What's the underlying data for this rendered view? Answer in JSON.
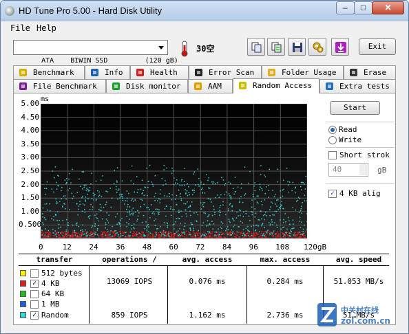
{
  "window": {
    "title": "HD Tune Pro 5.00 - Hard Disk Utility",
    "min": "–",
    "max": "□",
    "close": "✕"
  },
  "menu": {
    "file": "File",
    "help": "Help"
  },
  "toolbar": {
    "drive": "ATA    BIWIN SSD         (120 gB)",
    "temperature": "30空",
    "exit": "Exit",
    "icons": [
      "copy-icon",
      "copy-text-icon",
      "save-icon",
      "settings-icon",
      "download-icon"
    ]
  },
  "tabs_row1": [
    {
      "label": "Benchmark",
      "icon": "benchmark-icon"
    },
    {
      "label": "Info",
      "icon": "info-icon"
    },
    {
      "label": "Health",
      "icon": "health-icon"
    },
    {
      "label": "Error Scan",
      "icon": "error-scan-icon"
    },
    {
      "label": "Folder Usage",
      "icon": "folder-icon"
    },
    {
      "label": "Erase",
      "icon": "erase-icon"
    }
  ],
  "tabs_row2": [
    {
      "label": "File Benchmark",
      "icon": "file-benchmark-icon"
    },
    {
      "label": "Disk monitor",
      "icon": "disk-monitor-icon"
    },
    {
      "label": "AAM",
      "icon": "speaker-icon"
    },
    {
      "label": "Random Access",
      "icon": "random-access-icon"
    },
    {
      "label": "Extra tests",
      "icon": "extra-tests-icon"
    }
  ],
  "side": {
    "start": "Start",
    "read": "Read",
    "write": "Write",
    "short_stroke": "Short strok",
    "stroke_value": "40",
    "stroke_unit": "gB",
    "align": "4 KB alig"
  },
  "table": {
    "headers": [
      "transfer",
      "operations /",
      "avg. access",
      "max. access",
      "avg. speed"
    ],
    "legend": [
      {
        "label": "512 bytes",
        "color": "#f4f400",
        "checked": false
      },
      {
        "label": "4 KB",
        "color": "#e02020",
        "checked": true
      },
      {
        "label": "64 KB",
        "color": "#20c020",
        "checked": false
      },
      {
        "label": "1 MB",
        "color": "#2060e0",
        "checked": false
      },
      {
        "label": "Random",
        "color": "#30d8d8",
        "checked": true
      }
    ],
    "row_4kb": {
      "ops": "13069 IOPS",
      "avg": "0.076 ms",
      "max": "0.284 ms",
      "speed": "51.053 MB/s"
    },
    "row_random": {
      "ops": "859 IOPS",
      "avg": "1.162 ms",
      "max": "2.736 ms",
      "speed": "51…MB/s"
    }
  },
  "watermark": {
    "line1": "中关村在线",
    "line2": "zol.com.cn"
  },
  "chart_data": {
    "type": "scatter",
    "ylabel": "ms",
    "xlabel": "gB",
    "x_ticks": [
      "0",
      "12",
      "24",
      "36",
      "48",
      "60",
      "72",
      "84",
      "96",
      "108",
      "120gB"
    ],
    "y_ticks": [
      "5.00",
      "4.50",
      "4.00",
      "3.50",
      "3.00",
      "2.50",
      "2.00",
      "1.50",
      "1.00",
      "0.500"
    ],
    "xlim": [
      0,
      120
    ],
    "ylim": [
      0,
      5
    ],
    "grid": true,
    "series": [
      {
        "name": "4 KB",
        "color": "#e02020",
        "x_range": [
          0,
          120
        ],
        "y_range": [
          0.02,
          0.28
        ]
      },
      {
        "name": "Random",
        "color": "#30d8d8",
        "x_range": [
          0,
          120
        ],
        "y_range": [
          0.1,
          2.74
        ]
      }
    ]
  }
}
